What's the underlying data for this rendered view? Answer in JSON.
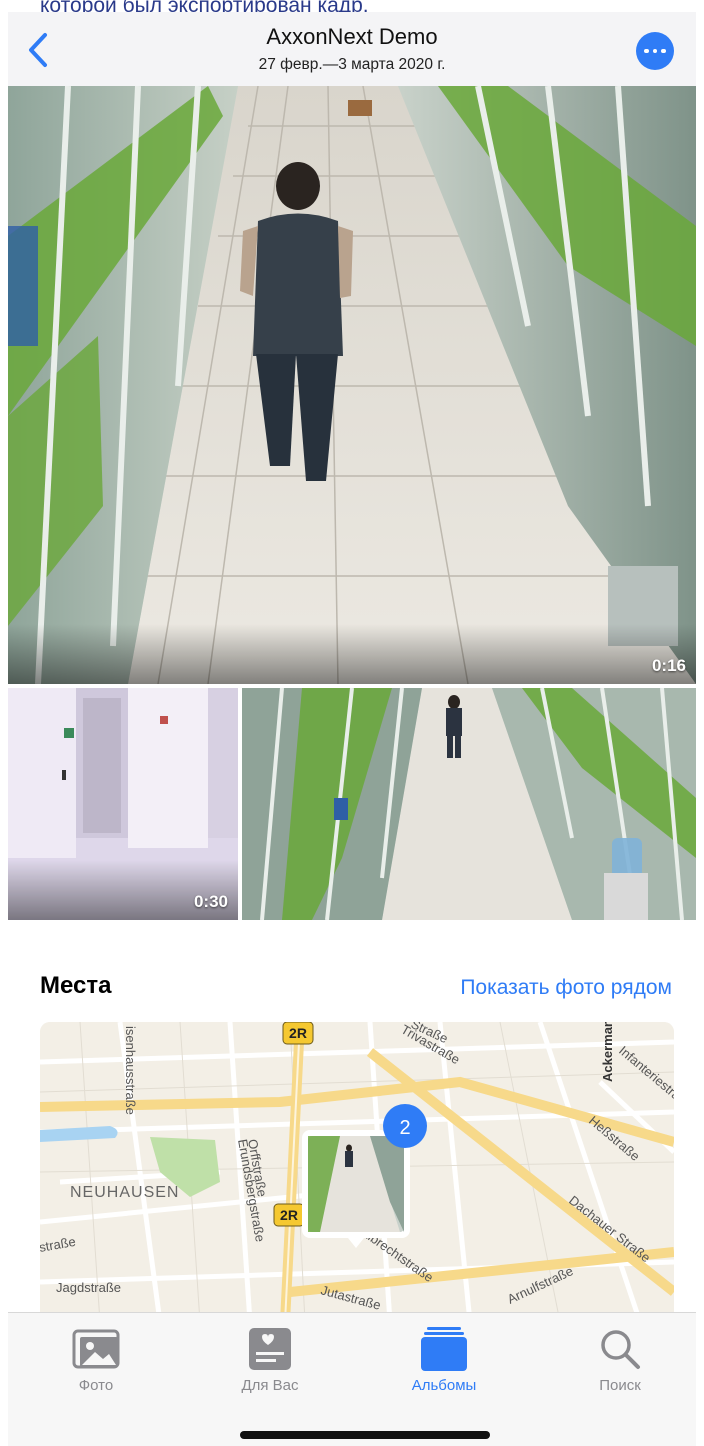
{
  "caption": "которой был экспортирован кадр.",
  "nav": {
    "title": "AxxonNext Demo",
    "subtitle": "27 февр.—3 марта 2020 г."
  },
  "media": [
    {
      "duration": "0:16"
    },
    {
      "duration": "0:30"
    },
    {
      "duration": ""
    }
  ],
  "places": {
    "title": "Места",
    "link": "Показать фото рядом"
  },
  "map": {
    "district": "NEUHAUSEN",
    "streets": [
      "isenhausstraße",
      "Trivastraße",
      "Straße",
      "Infanteriestraße",
      "Heßstraße",
      "Orffstraße",
      "Erundsbergstraße",
      "Dachauer Straße",
      "Albrechtstraße",
      "Jutastraße",
      "Jagdstraße",
      "Arnulfstraße",
      "Ackermannstraße",
      "straße"
    ],
    "road_badge": "2R",
    "cluster_count": "2"
  },
  "tabs": [
    {
      "label": "Фото",
      "icon": "photos-icon",
      "active": false
    },
    {
      "label": "Для Вас",
      "icon": "for-you-icon",
      "active": false
    },
    {
      "label": "Альбомы",
      "icon": "albums-icon",
      "active": true
    },
    {
      "label": "Поиск",
      "icon": "search-icon",
      "active": false
    }
  ],
  "colors": {
    "accent": "#2f7cf6",
    "green": "#6aa83a"
  }
}
